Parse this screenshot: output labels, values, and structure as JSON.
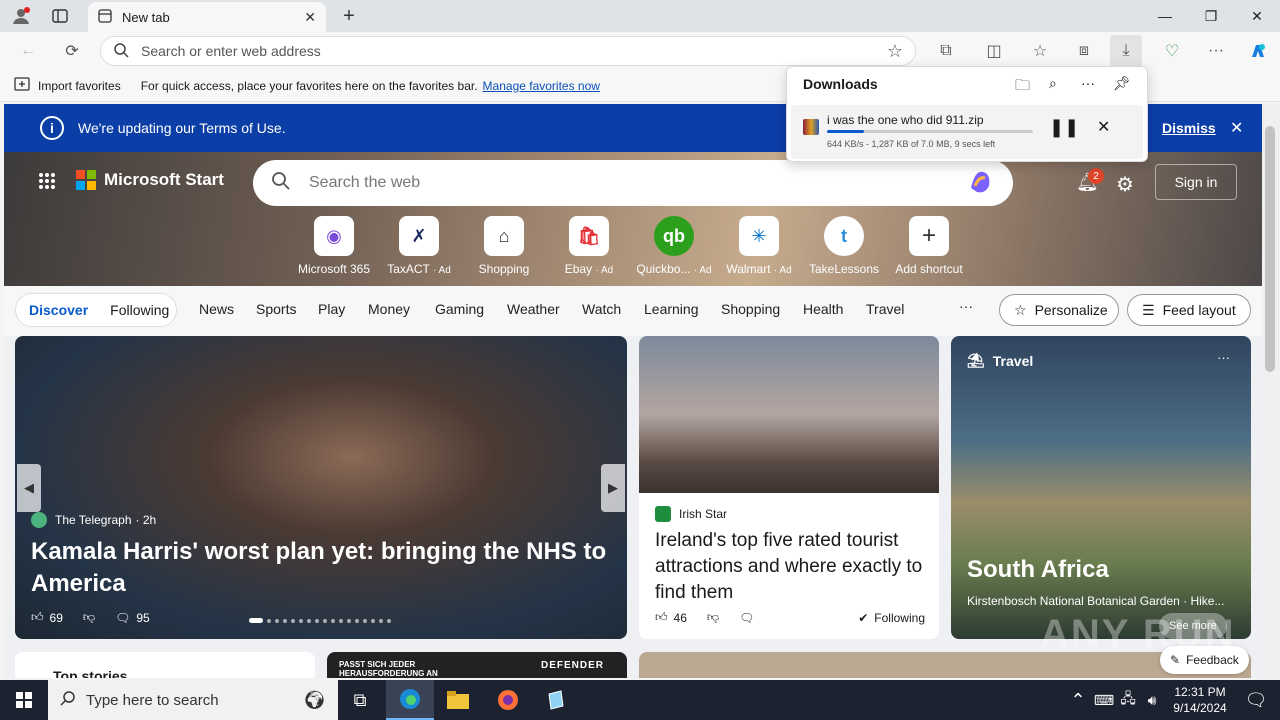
{
  "browser": {
    "tab_title": "New tab",
    "address_placeholder": "Search or enter web address"
  },
  "favorites_bar": {
    "import_label": "Import favorites",
    "hint_text": "For quick access, place your favorites here on the favorites bar.",
    "manage_link": "Manage favorites now"
  },
  "banner": {
    "text": "We're updating our Terms of Use.",
    "dismiss_label": "Dismiss"
  },
  "header": {
    "brand": "Microsoft Start",
    "search_placeholder": "Search the web",
    "notification_count": "2",
    "signin_label": "Sign in"
  },
  "shortcuts": [
    {
      "label": "Microsoft 365",
      "ad": ""
    },
    {
      "label": "TaxACT",
      "ad": "· Ad"
    },
    {
      "label": "Shopping",
      "ad": ""
    },
    {
      "label": "Ebay",
      "ad": "· Ad"
    },
    {
      "label": "Quickbo...",
      "ad": "· Ad"
    },
    {
      "label": "Walmart",
      "ad": "· Ad"
    },
    {
      "label": "TakeLessons",
      "ad": ""
    },
    {
      "label": "Add shortcut",
      "ad": ""
    }
  ],
  "feed_nav": {
    "discover": "Discover",
    "following": "Following",
    "tabs": [
      "News",
      "Sports",
      "Play",
      "Money",
      "Gaming",
      "Weather",
      "Watch",
      "Learning",
      "Shopping",
      "Health",
      "Travel"
    ],
    "more": "···",
    "personalize": "Personalize",
    "feed_layout": "Feed layout"
  },
  "main_story": {
    "source": "The Telegraph",
    "age": "· 2h",
    "headline": "Kamala Harris' worst plan yet: bringing the NHS to America",
    "likes": "69",
    "comments": "95"
  },
  "story2": {
    "source": "Irish Star",
    "headline": "Ireland's top five rated tourist attractions and where exactly to find them",
    "likes": "46",
    "following": "Following"
  },
  "travel": {
    "label": "Travel",
    "title": "South Africa",
    "subtitle": "Kirstenbosch National Botanical Garden · Hike...",
    "see_more": "See more"
  },
  "bottom_row": {
    "top_stories": "Top stories",
    "ad_text": "PASST SICH JEDER HERAUSFORDERUNG AN",
    "ad_brand": "DEFENDER",
    "feedback": "Feedback"
  },
  "downloads": {
    "title": "Downloads",
    "file_name": "i was the one who did 911.zip",
    "status": "644 KB/s - 1,287 KB of 7.0 MB, 9 secs left",
    "progress": 0.18
  },
  "taskbar": {
    "search_placeholder": "Type here to search",
    "time": "12:31 PM",
    "date": "9/14/2024"
  },
  "watermark": "ANY RUN"
}
